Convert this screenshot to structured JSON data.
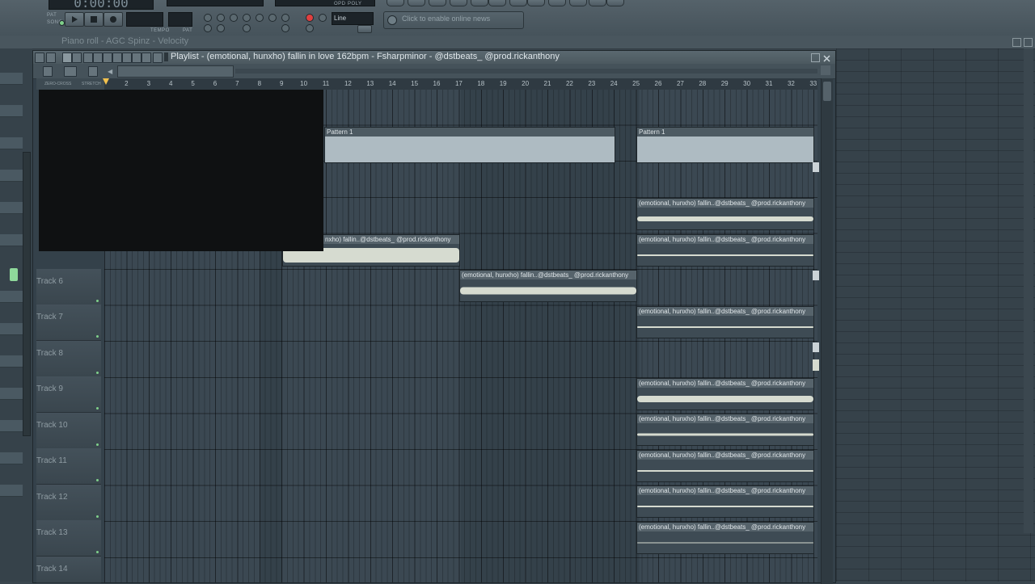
{
  "toolbar": {
    "time": "0:00:00",
    "tempo_label": "TEMPO",
    "pat_label": "PAT",
    "snap": "Line",
    "news": "Click to enable online news",
    "pat_song_labels": [
      "PAT",
      "SONG"
    ],
    "mode_labels": [
      "OPD",
      "POLY"
    ]
  },
  "piano_roll_bar": {
    "text": "Piano roll - AGC Spinz - Velocity"
  },
  "playlist": {
    "title": "Playlist - (emotional, hunxho) fallin in love 162bpm - Fsharpminor - @dstbeats_ @prod.rickanthony",
    "toggles": [
      "ZERO-CROSS",
      "STRETCH"
    ],
    "ruler_ticks": [
      "2",
      "3",
      "4",
      "5",
      "6",
      "7",
      "8",
      "9",
      "10",
      "11",
      "12",
      "13",
      "14",
      "15",
      "16",
      "17",
      "18",
      "19",
      "20",
      "21",
      "22",
      "23",
      "24",
      "25",
      "26",
      "27",
      "28",
      "29",
      "30",
      "31",
      "32",
      "33"
    ],
    "tracks": [
      "Track 6",
      "Track 7",
      "Track 8",
      "Track 9",
      "Track 10",
      "Track 11",
      "Track 12",
      "Track 13",
      "Track 14"
    ],
    "pattern_label": "Pattern 1",
    "clip_label": "(emotional, hunxho) fallin..@dstbeats_ @prod.rickanthony",
    "clip_label_cut": "nxho) fallin..@dstbeats_ @prod.rickanthony"
  },
  "colors": {
    "accent_green": "#7fd08a",
    "record_red": "#e04040",
    "grid_bg": "#34414a"
  }
}
